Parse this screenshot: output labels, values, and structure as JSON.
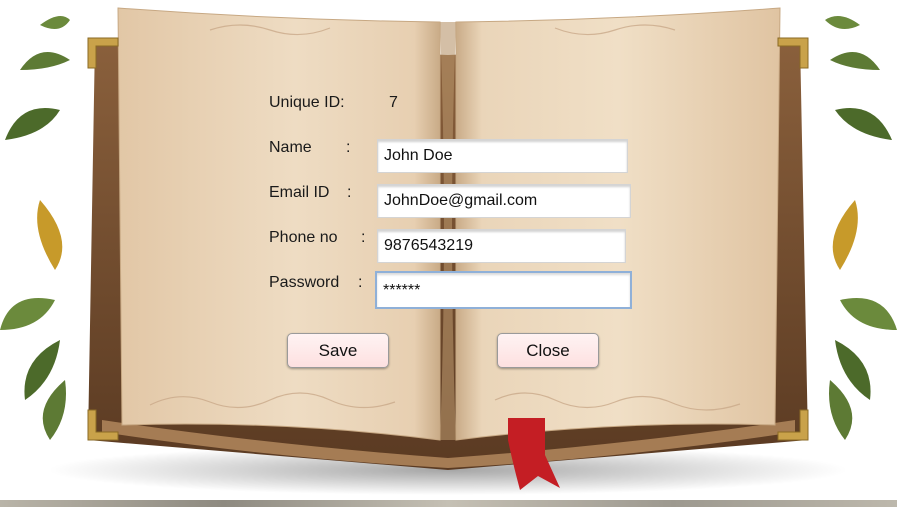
{
  "form": {
    "unique_id_label": "Unique ID:",
    "unique_id_value": "7",
    "name_label": "Name",
    "email_label": "Email ID",
    "phone_label": "Phone no",
    "password_label": "Password",
    "colon": ":",
    "name_value": "John Doe",
    "email_value": "JohnDoe@gmail.com",
    "phone_value": "9876543219",
    "password_value": "******"
  },
  "buttons": {
    "save_label": "Save",
    "close_label": "Close"
  },
  "colors": {
    "page": "#ecd8bd",
    "cover": "#6e4a2e",
    "ribbon": "#c41e24",
    "button_fill": "#fde6e6",
    "focus_border": "#8fb0d8"
  }
}
